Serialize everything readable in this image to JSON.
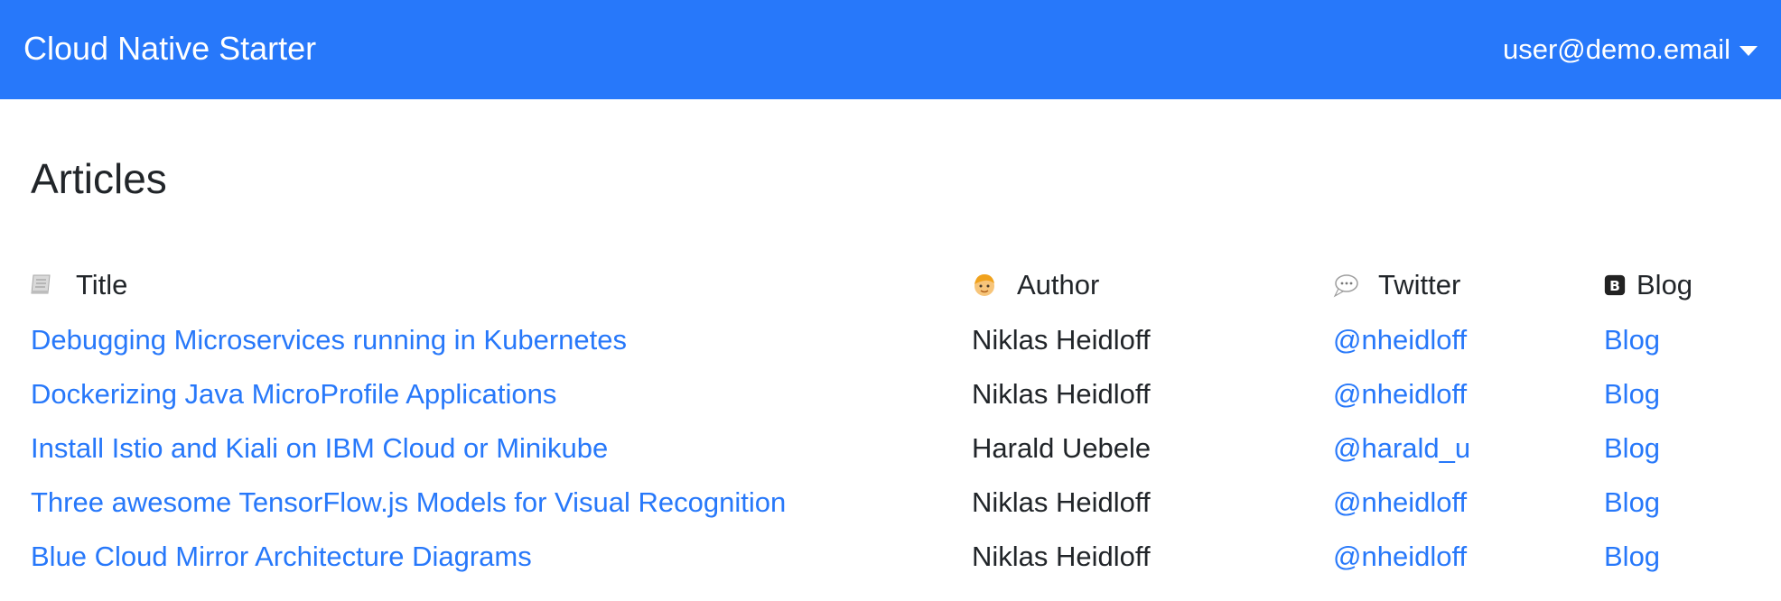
{
  "app": {
    "brand": "Cloud Native Starter",
    "user": "user@demo.email"
  },
  "page": {
    "title": "Articles"
  },
  "table": {
    "headers": {
      "title": "Title",
      "author": "Author",
      "twitter": "Twitter",
      "blog": "Blog"
    },
    "rows": [
      {
        "title": "Debugging Microservices running in Kubernetes",
        "author": "Niklas Heidloff",
        "twitter": "@nheidloff",
        "blog": "Blog"
      },
      {
        "title": "Dockerizing Java MicroProfile Applications",
        "author": "Niklas Heidloff",
        "twitter": "@nheidloff",
        "blog": "Blog"
      },
      {
        "title": "Install Istio and Kiali on IBM Cloud or Minikube",
        "author": "Harald Uebele",
        "twitter": "@harald_u",
        "blog": "Blog"
      },
      {
        "title": "Three awesome TensorFlow.js Models for Visual Recognition",
        "author": "Niklas Heidloff",
        "twitter": "@nheidloff",
        "blog": "Blog"
      },
      {
        "title": "Blue Cloud Mirror Architecture Diagrams",
        "author": "Niklas Heidloff",
        "twitter": "@nheidloff",
        "blog": "Blog"
      }
    ]
  },
  "icons": {
    "title": "scroll-icon",
    "author": "person-icon",
    "twitter": "speech-bubble-icon",
    "blog": "b-letter-icon"
  },
  "colors": {
    "navbar": "#2778fa",
    "link": "#2778fa",
    "text": "#212529"
  }
}
